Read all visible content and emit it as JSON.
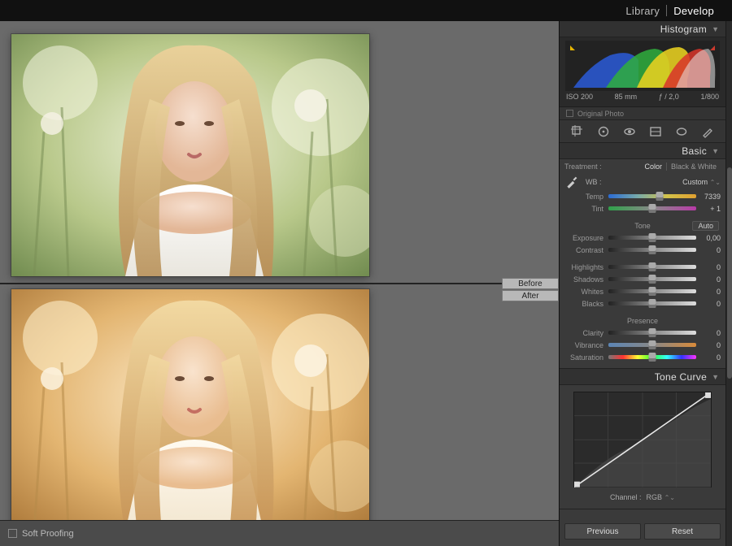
{
  "modules": {
    "library": "Library",
    "develop": "Develop"
  },
  "beforeAfter": {
    "before": "Before",
    "after": "After"
  },
  "bottomToolbar": {
    "softProofing": "Soft Proofing"
  },
  "histogram": {
    "title": "Histogram",
    "iso": "ISO 200",
    "focal": "85 mm",
    "aperture": "ƒ / 2,0",
    "shutter": "1/800",
    "original": "Original Photo"
  },
  "tools": {
    "crop": "crop-icon",
    "spot": "spot-removal-icon",
    "redeye": "red-eye-icon",
    "grad": "graduated-filter-icon",
    "radial": "radial-filter-icon",
    "brush": "adjustment-brush-icon"
  },
  "basic": {
    "title": "Basic",
    "treatment": "Treatment :",
    "color": "Color",
    "bw": "Black & White",
    "wbLabel": "WB :",
    "wbValue": "Custom",
    "tempLabel": "Temp",
    "tempValue": "7339",
    "tintLabel": "Tint",
    "tintValue": "+ 1",
    "toneHeader": "Tone",
    "auto": "Auto",
    "presenceHeader": "Presence",
    "tone": {
      "exposure": {
        "label": "Exposure",
        "value": "0,00"
      },
      "contrast": {
        "label": "Contrast",
        "value": "0"
      },
      "highlights": {
        "label": "Highlights",
        "value": "0"
      },
      "shadows": {
        "label": "Shadows",
        "value": "0"
      },
      "whites": {
        "label": "Whites",
        "value": "0"
      },
      "blacks": {
        "label": "Blacks",
        "value": "0"
      }
    },
    "presence": {
      "clarity": {
        "label": "Clarity",
        "value": "0"
      },
      "vibrance": {
        "label": "Vibrance",
        "value": "0"
      },
      "saturation": {
        "label": "Saturation",
        "value": "0"
      }
    }
  },
  "toneCurve": {
    "title": "Tone Curve",
    "channelLabel": "Channel :",
    "channelValue": "RGB"
  },
  "buttons": {
    "previous": "Previous",
    "reset": "Reset"
  }
}
